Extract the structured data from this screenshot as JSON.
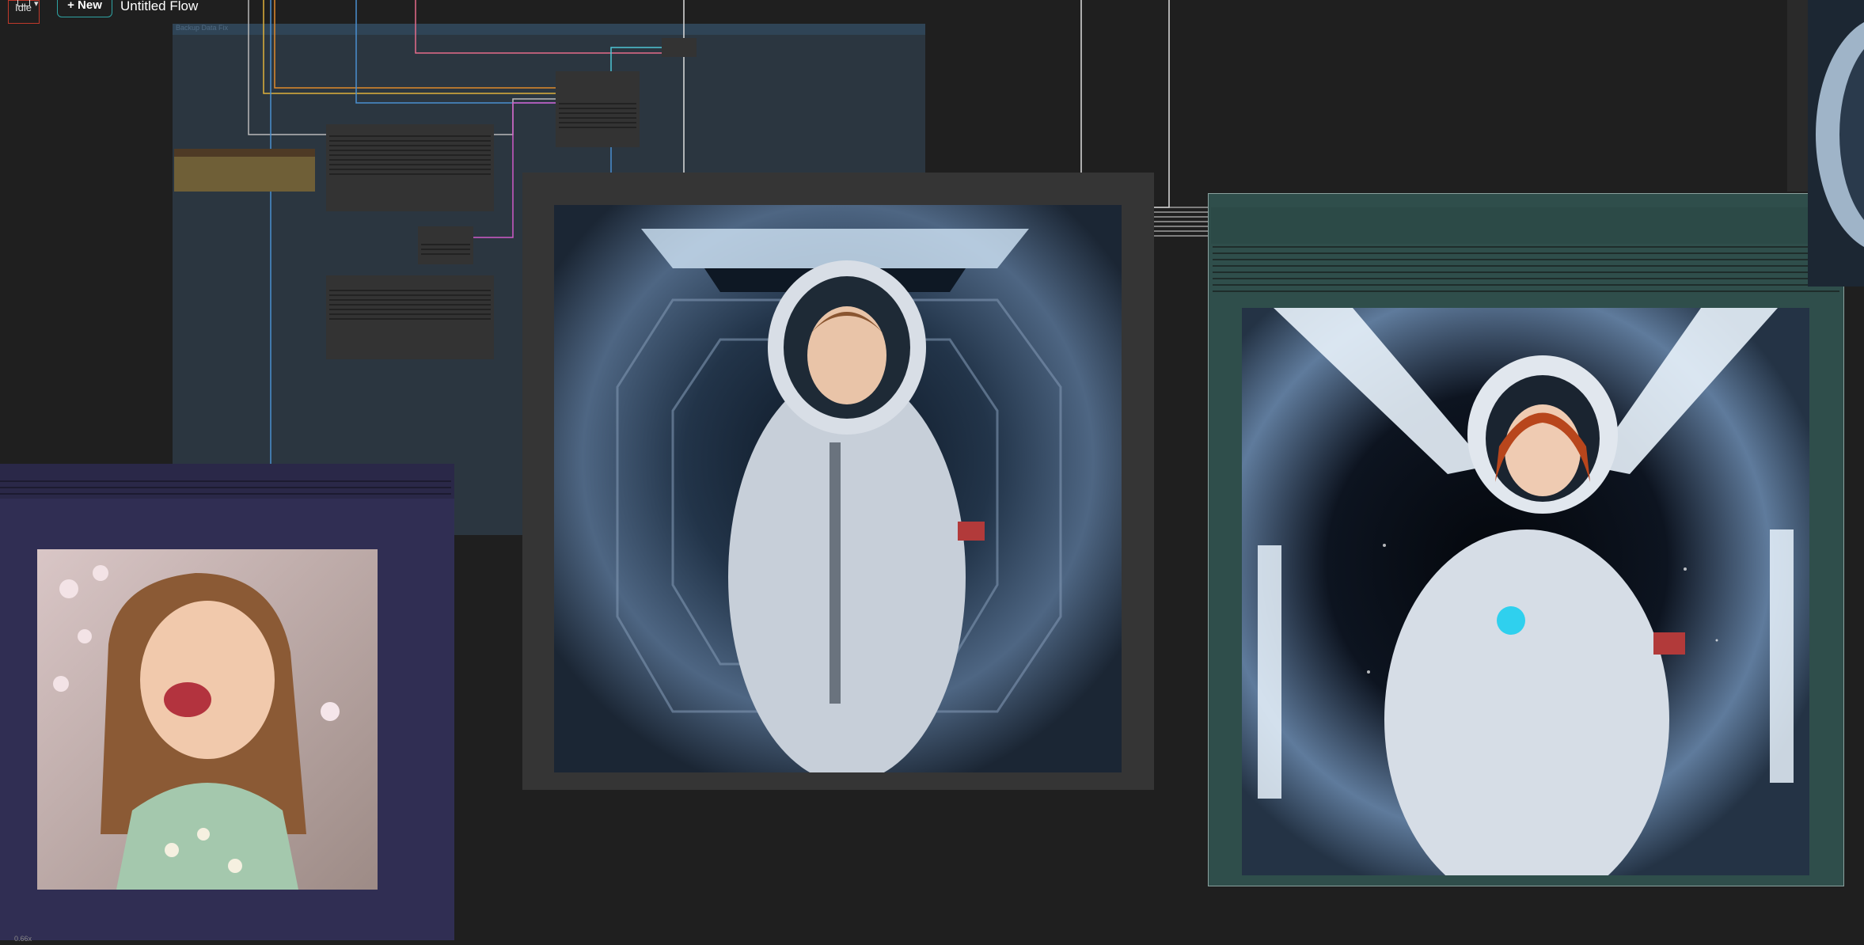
{
  "topbar": {
    "status": "Idle",
    "new_button": "+ New",
    "flow_title": "Untitled Flow"
  },
  "group": {
    "title": "Backup Data Fix"
  },
  "canvas": {
    "zoom_label": "0.66x"
  },
  "images": {
    "center": "Astronaut woman with brown hair inside spaceship corridor",
    "right": "Astronaut woman with red hair floating in spaceship corridor",
    "left": "Girl with long hair holding a blossom, laughing",
    "edge": "Partial astronaut helmet at right edge"
  },
  "colors": {
    "canvas": "#1f1f1f",
    "group": "#2b3640",
    "accent_new": "#2fa3a3",
    "status_border": "#c0392b",
    "wire_pink": "#e66c8a",
    "wire_yellow": "#e0b13a",
    "wire_orange": "#e08a2a",
    "wire_blue": "#4a8fd0",
    "wire_cyan": "#4ec5d6",
    "wire_magenta": "#d05ac8"
  },
  "icons": [
    "save-icon",
    "chevron-down-icon"
  ]
}
